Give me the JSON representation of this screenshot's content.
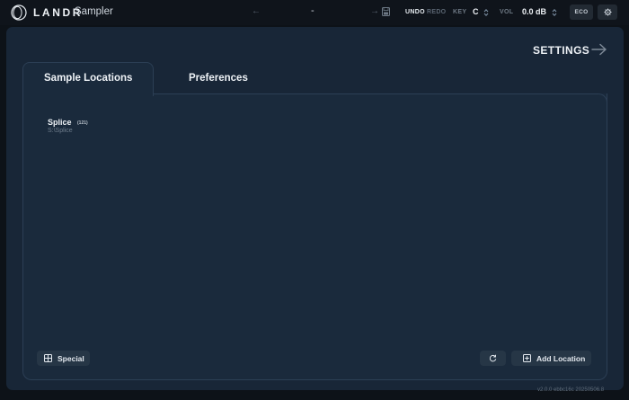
{
  "topbar": {
    "brand": "LANDR",
    "app_name": "Sampler",
    "preset": "-",
    "undo": "UNDO",
    "redo": "REDO",
    "key_label": "KEY",
    "key_value": "C",
    "vol_label": "VOL",
    "vol_value": "0.0 dB",
    "eco": "ECO",
    "icons": [
      "landr-logo-icon",
      "arrow-left-icon",
      "arrow-right-icon",
      "save-icon",
      "updown-icon",
      "gear-icon"
    ]
  },
  "settings": {
    "title": "SETTINGS",
    "tabs": [
      {
        "label": "Sample Locations",
        "active": true
      },
      {
        "label": "Preferences",
        "active": false
      }
    ],
    "locations": [
      {
        "name": "Splice",
        "count": "(121)",
        "path": "S:\\Splice"
      }
    ],
    "buttons": {
      "special": "Special",
      "add_location": "Add Location"
    }
  },
  "version": "v2.0.0 ebbc16c 20250506.8",
  "colors": {
    "background": "#0d1218",
    "panel": "#182637",
    "accent_text": "#eef2f6",
    "muted": "#6f7d8c"
  }
}
